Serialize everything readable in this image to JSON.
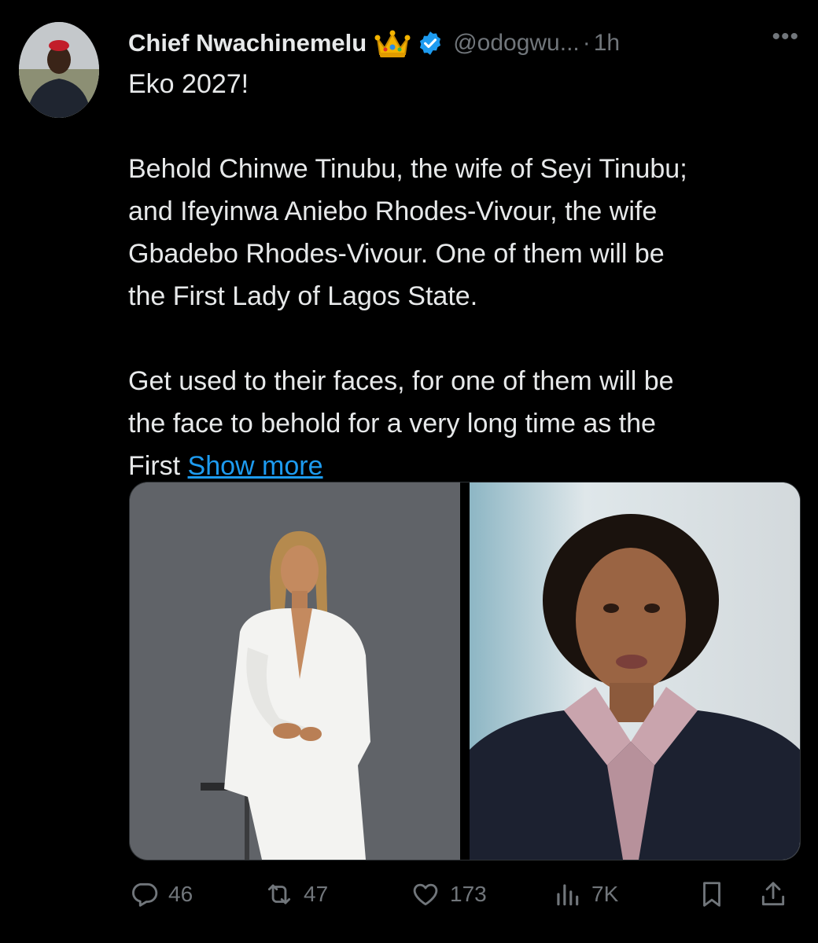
{
  "tweet": {
    "author_name": "Chief Nwachinemelu",
    "handle": "@odogwu...",
    "separator": "·",
    "time": "1h",
    "more_label": "•••",
    "text_lines": [
      "Eko 2027!",
      "",
      "Behold Chinwe Tinubu, the wife of Seyi Tinubu;",
      "and Ifeyinwa Aniebo Rhodes-Vivour, the wife",
      "Gbadebo Rhodes-Vivour. One of them will be",
      "the First Lady of Lagos State.",
      "",
      "Get used to their faces, for one of them will be",
      "the face to behold for a very long time as the",
      "First "
    ],
    "show_more": "Show more"
  },
  "actions": {
    "replies": "46",
    "retweets": "47",
    "likes": "173",
    "views": "7K"
  },
  "icons": {
    "crown": "crown-emoji",
    "verified": "verified-badge-icon",
    "reply": "reply-icon",
    "retweet": "retweet-icon",
    "like": "heart-icon",
    "views": "views-icon",
    "bookmark": "bookmark-icon",
    "share": "share-icon"
  },
  "colors": {
    "background": "#000000",
    "text": "#e7e9ea",
    "muted": "#71767b",
    "link": "#1d9bf0",
    "verified": "#1d9bf0"
  }
}
